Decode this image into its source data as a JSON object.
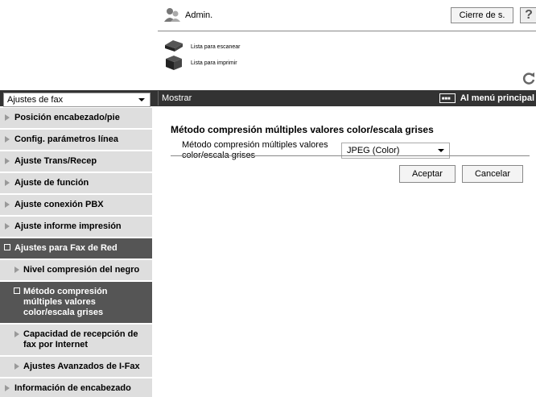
{
  "header": {
    "user_label": "Admin.",
    "logout_label": "Cierre de s.",
    "help_label": "?"
  },
  "status": [
    {
      "icon": "scanner-icon",
      "text": "Lista para escanear"
    },
    {
      "icon": "printer-icon",
      "text": "Lista para imprimir"
    }
  ],
  "toolbar": {
    "section_select": "Ajustes de fax",
    "show_label": "Mostrar",
    "main_menu_label": "Al menú principal"
  },
  "sidebar": {
    "items": [
      {
        "label": "Posición encabezado/pie"
      },
      {
        "label": "Config. parámetros línea"
      },
      {
        "label": "Ajuste Trans/Recep"
      },
      {
        "label": "Ajuste de función"
      },
      {
        "label": "Ajuste conexión PBX"
      },
      {
        "label": "Ajuste informe impresión"
      },
      {
        "label": "Ajustes para Fax de Red"
      },
      {
        "label": "Nivel compresión del negro"
      },
      {
        "label": "Método compresión múltiples valores color/escala grises"
      },
      {
        "label": "Capacidad de recepción de fax por Internet"
      },
      {
        "label": "Ajustes Avanzados de I-Fax"
      },
      {
        "label": "Información de encabezado"
      }
    ]
  },
  "main": {
    "title": "Método compresión múltiples valores color/escala grises",
    "field_label": "Método compresión múltiples valores color/escala grises",
    "field_value": "JPEG (Color)",
    "ok_label": "Aceptar",
    "cancel_label": "Cancelar"
  },
  "colors": {
    "topbar": "#333333",
    "active_nav": "#555555",
    "nav_bg": "#dedede"
  }
}
